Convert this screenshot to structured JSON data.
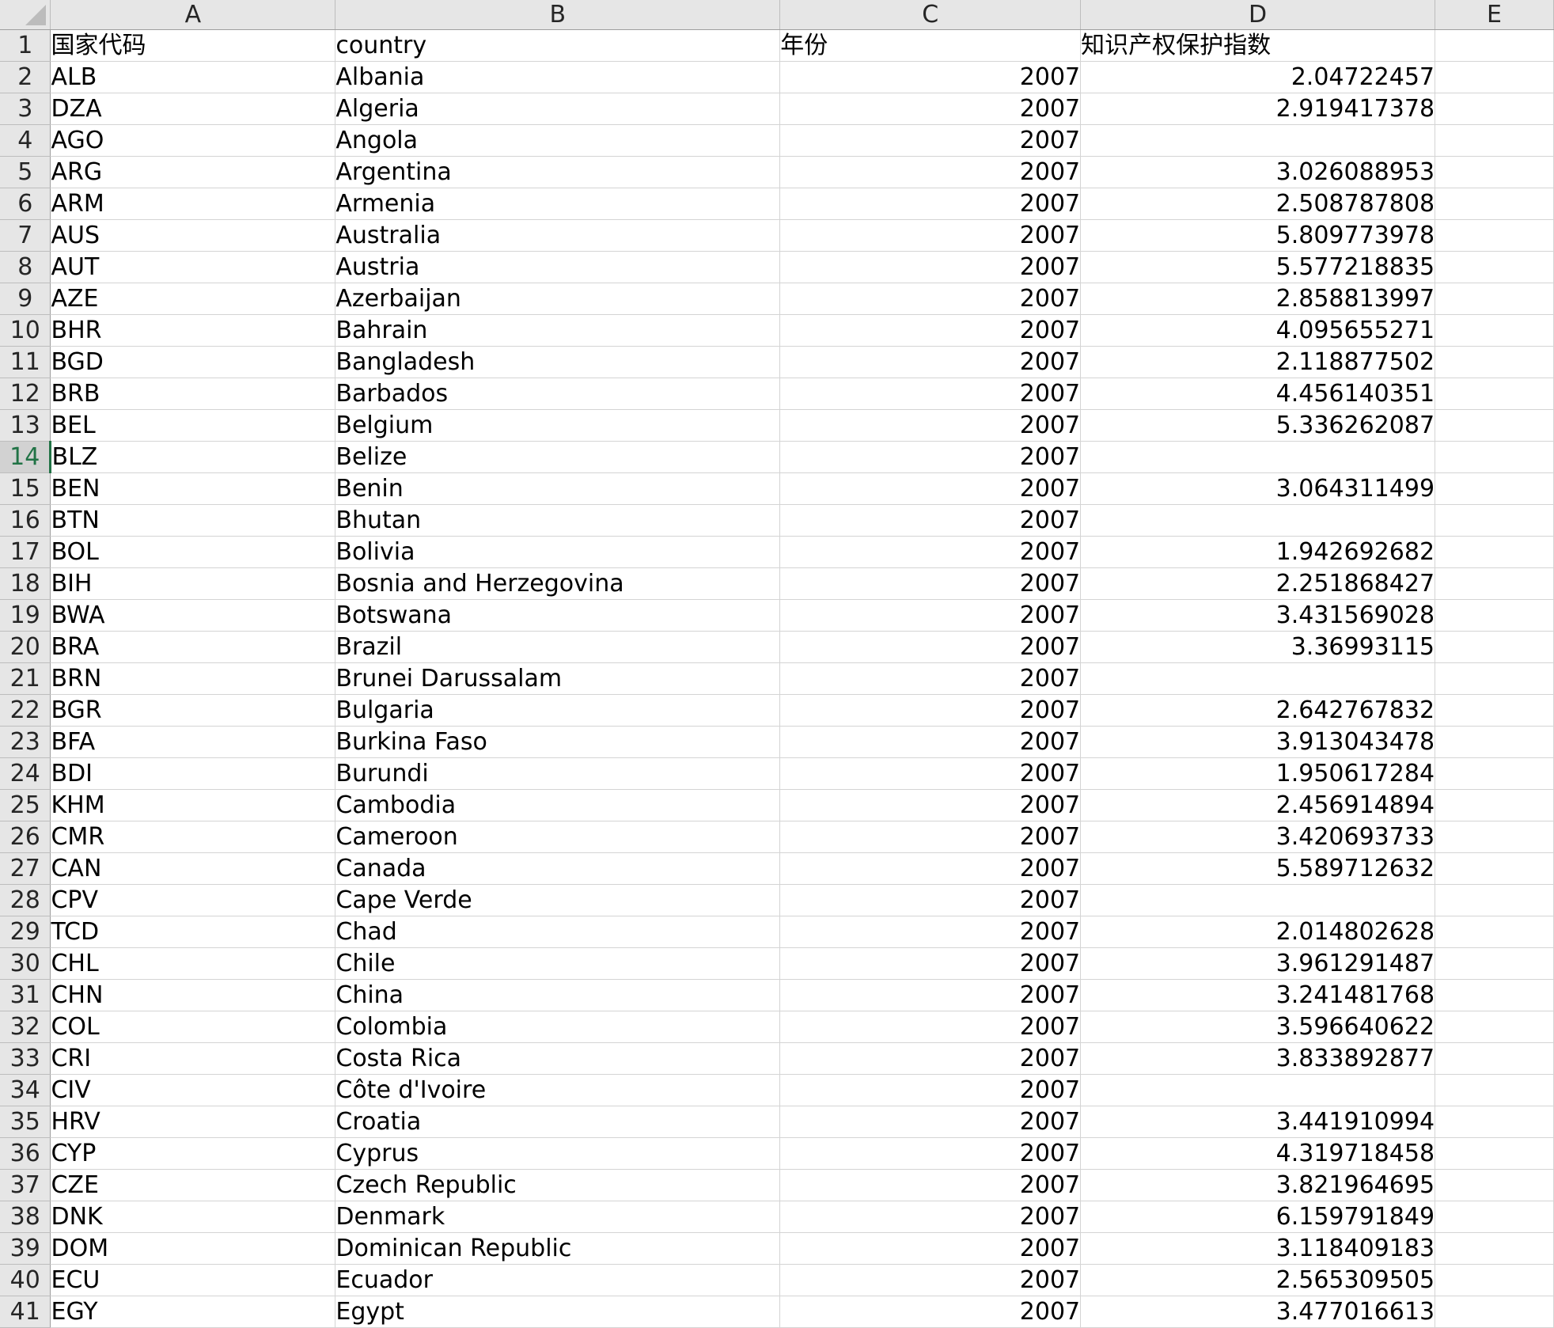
{
  "columns": [
    "A",
    "B",
    "C",
    "D",
    "E"
  ],
  "active_row": 14,
  "rows": [
    {
      "n": "1",
      "a": "国家代码",
      "b": "country",
      "c": "年份",
      "d": "知识产权保护指数",
      "header": true
    },
    {
      "n": "2",
      "a": "ALB",
      "b": "Albania",
      "c": "2007",
      "d": "2.04722457"
    },
    {
      "n": "3",
      "a": "DZA",
      "b": "Algeria",
      "c": "2007",
      "d": "2.919417378"
    },
    {
      "n": "4",
      "a": "AGO",
      "b": "Angola",
      "c": "2007",
      "d": ""
    },
    {
      "n": "5",
      "a": "ARG",
      "b": "Argentina",
      "c": "2007",
      "d": "3.026088953"
    },
    {
      "n": "6",
      "a": "ARM",
      "b": "Armenia",
      "c": "2007",
      "d": "2.508787808"
    },
    {
      "n": "7",
      "a": "AUS",
      "b": "Australia",
      "c": "2007",
      "d": "5.809773978"
    },
    {
      "n": "8",
      "a": "AUT",
      "b": "Austria",
      "c": "2007",
      "d": "5.577218835"
    },
    {
      "n": "9",
      "a": "AZE",
      "b": "Azerbaijan",
      "c": "2007",
      "d": "2.858813997"
    },
    {
      "n": "10",
      "a": "BHR",
      "b": "Bahrain",
      "c": "2007",
      "d": "4.095655271"
    },
    {
      "n": "11",
      "a": "BGD",
      "b": "Bangladesh",
      "c": "2007",
      "d": "2.118877502"
    },
    {
      "n": "12",
      "a": "BRB",
      "b": "Barbados",
      "c": "2007",
      "d": "4.456140351"
    },
    {
      "n": "13",
      "a": "BEL",
      "b": "Belgium",
      "c": "2007",
      "d": "5.336262087"
    },
    {
      "n": "14",
      "a": "BLZ",
      "b": "Belize",
      "c": "2007",
      "d": ""
    },
    {
      "n": "15",
      "a": "BEN",
      "b": "Benin",
      "c": "2007",
      "d": "3.064311499"
    },
    {
      "n": "16",
      "a": "BTN",
      "b": "Bhutan",
      "c": "2007",
      "d": ""
    },
    {
      "n": "17",
      "a": "BOL",
      "b": "Bolivia",
      "c": "2007",
      "d": "1.942692682"
    },
    {
      "n": "18",
      "a": "BIH",
      "b": "Bosnia and Herzegovina",
      "c": "2007",
      "d": "2.251868427"
    },
    {
      "n": "19",
      "a": "BWA",
      "b": "Botswana",
      "c": "2007",
      "d": "3.431569028"
    },
    {
      "n": "20",
      "a": "BRA",
      "b": "Brazil",
      "c": "2007",
      "d": "3.36993115"
    },
    {
      "n": "21",
      "a": "BRN",
      "b": "Brunei Darussalam",
      "c": "2007",
      "d": ""
    },
    {
      "n": "22",
      "a": "BGR",
      "b": "Bulgaria",
      "c": "2007",
      "d": "2.642767832"
    },
    {
      "n": "23",
      "a": "BFA",
      "b": "Burkina Faso",
      "c": "2007",
      "d": "3.913043478"
    },
    {
      "n": "24",
      "a": "BDI",
      "b": "Burundi",
      "c": "2007",
      "d": "1.950617284"
    },
    {
      "n": "25",
      "a": "KHM",
      "b": "Cambodia",
      "c": "2007",
      "d": "2.456914894"
    },
    {
      "n": "26",
      "a": "CMR",
      "b": "Cameroon",
      "c": "2007",
      "d": "3.420693733"
    },
    {
      "n": "27",
      "a": "CAN",
      "b": "Canada",
      "c": "2007",
      "d": "5.589712632"
    },
    {
      "n": "28",
      "a": "CPV",
      "b": "Cape Verde",
      "c": "2007",
      "d": ""
    },
    {
      "n": "29",
      "a": "TCD",
      "b": "Chad",
      "c": "2007",
      "d": "2.014802628"
    },
    {
      "n": "30",
      "a": "CHL",
      "b": "Chile",
      "c": "2007",
      "d": "3.961291487"
    },
    {
      "n": "31",
      "a": "CHN",
      "b": "China",
      "c": "2007",
      "d": "3.241481768"
    },
    {
      "n": "32",
      "a": "COL",
      "b": "Colombia",
      "c": "2007",
      "d": "3.596640622"
    },
    {
      "n": "33",
      "a": "CRI",
      "b": "Costa Rica",
      "c": "2007",
      "d": "3.833892877"
    },
    {
      "n": "34",
      "a": "CIV",
      "b": "Côte d'Ivoire",
      "c": "2007",
      "d": ""
    },
    {
      "n": "35",
      "a": "HRV",
      "b": "Croatia",
      "c": "2007",
      "d": "3.441910994"
    },
    {
      "n": "36",
      "a": "CYP",
      "b": "Cyprus",
      "c": "2007",
      "d": "4.319718458"
    },
    {
      "n": "37",
      "a": "CZE",
      "b": "Czech Republic",
      "c": "2007",
      "d": "3.821964695"
    },
    {
      "n": "38",
      "a": "DNK",
      "b": "Denmark",
      "c": "2007",
      "d": "6.159791849"
    },
    {
      "n": "39",
      "a": "DOM",
      "b": "Dominican Republic",
      "c": "2007",
      "d": "3.118409183"
    },
    {
      "n": "40",
      "a": "ECU",
      "b": "Ecuador",
      "c": "2007",
      "d": "2.565309505"
    },
    {
      "n": "41",
      "a": "EGY",
      "b": "Egypt",
      "c": "2007",
      "d": "3.477016613"
    }
  ]
}
